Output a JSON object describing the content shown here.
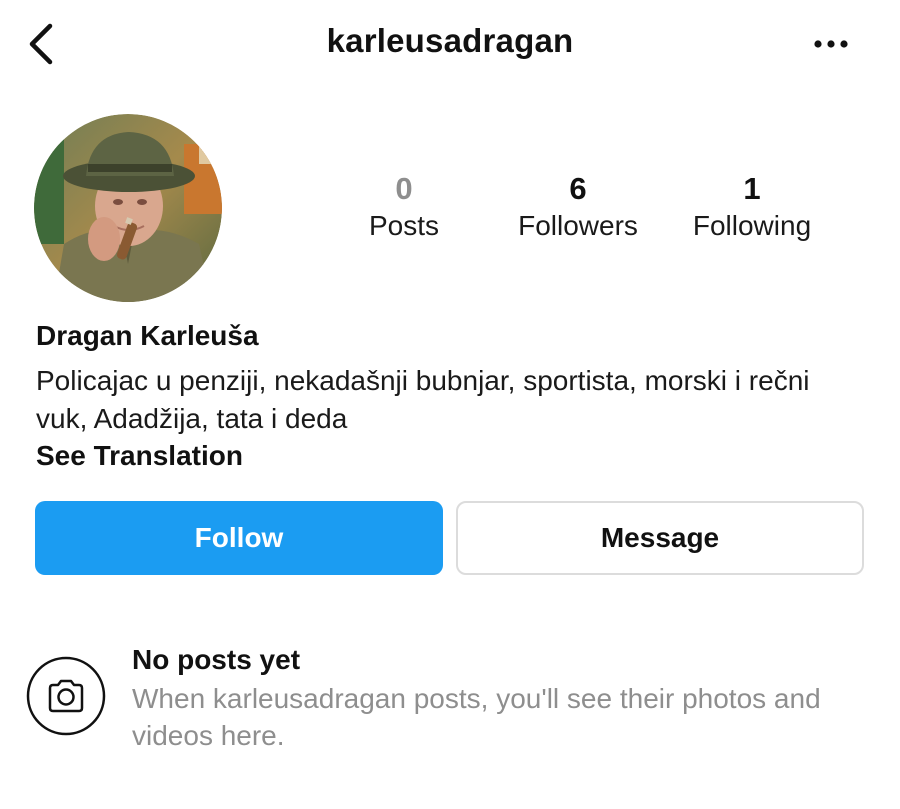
{
  "header": {
    "title": "karleusadragan",
    "back_icon": "chevron-left-icon",
    "more_icon": "more-horizontal-icon"
  },
  "profile": {
    "avatar_icon": "profile-photo",
    "stats": {
      "posts": {
        "value": "0",
        "label": "Posts"
      },
      "followers": {
        "value": "6",
        "label": "Followers"
      },
      "following": {
        "value": "1",
        "label": "Following"
      }
    },
    "display_name": "Dragan Karleuša",
    "bio": "Policajac u penziji, nekadašnji bubnjar, sportista, morski i rečni vuk, Adadžija, tata i deda",
    "see_translation": "See Translation"
  },
  "actions": {
    "follow_label": "Follow",
    "message_label": "Message"
  },
  "empty_state": {
    "icon": "camera-icon",
    "title": "No posts yet",
    "text": "When karleusadragan posts, you'll see their photos and videos here."
  },
  "colors": {
    "follow_button": "#1b9cf2",
    "muted_text": "#8e8e8e",
    "border": "#dcdcdc"
  }
}
